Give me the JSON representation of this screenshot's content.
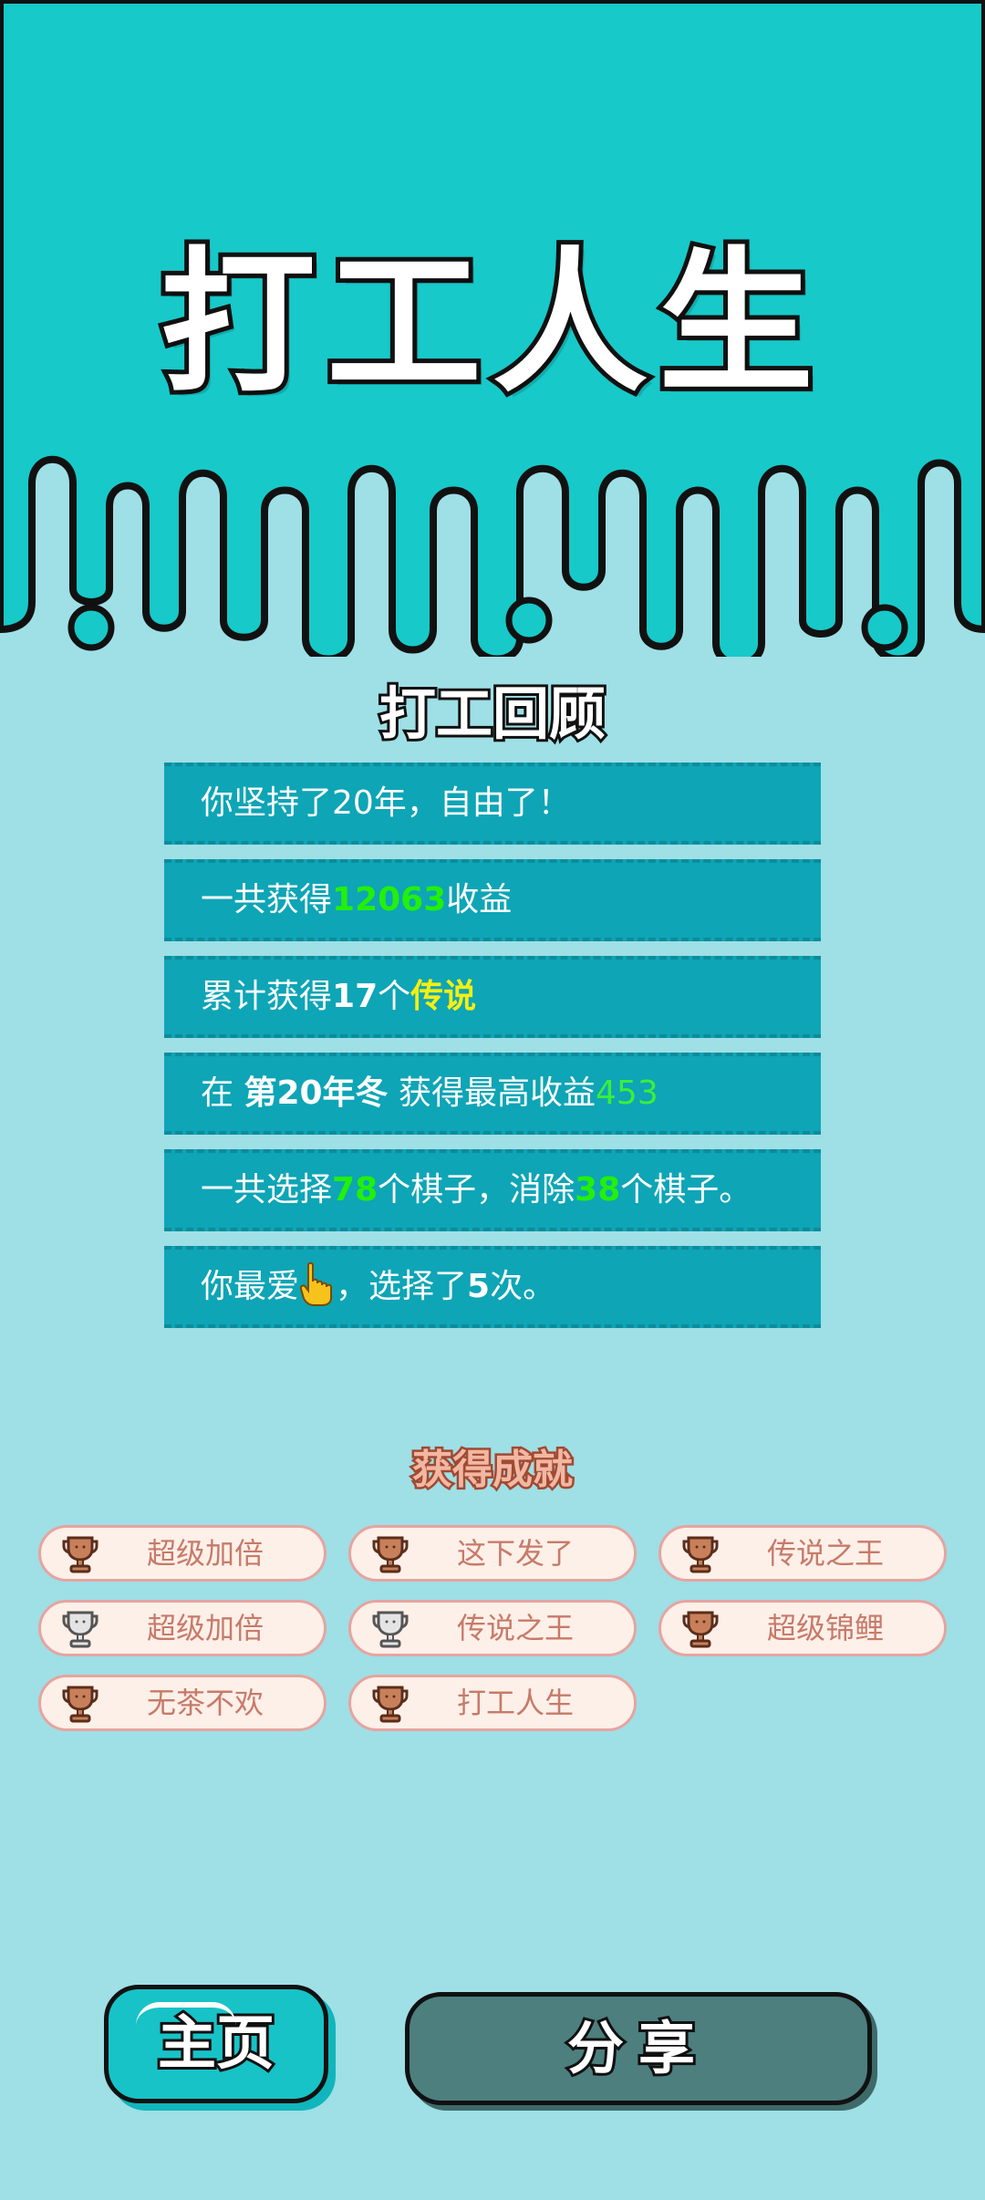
{
  "title": "打工人生",
  "review": {
    "heading": "打工回顾",
    "rows": {
      "years": {
        "text": "你坚持了20年，自由了！"
      },
      "income": {
        "prefix": "一共获得",
        "value": "12063",
        "suffix": "收益"
      },
      "legend": {
        "prefix": "累计获得",
        "count": "17",
        "mid": "个",
        "word": "传说"
      },
      "best": {
        "prefix": "在 ",
        "period": "第20年冬",
        "mid": " 获得最高收益",
        "value": "453"
      },
      "pieces": {
        "prefix": "一共选择",
        "chosen": "78",
        "mid": "个棋子，消除",
        "removed": "38",
        "suffix": "个棋子。"
      },
      "favorite": {
        "prefix": "你最爱",
        "icon": "pointing-hand-icon",
        "mid": "，选择了",
        "count": "5",
        "suffix": "次。"
      }
    }
  },
  "achievements": {
    "heading": "获得成就",
    "items": [
      {
        "label": "超级加倍",
        "trophy": "bronze"
      },
      {
        "label": "这下发了",
        "trophy": "bronze"
      },
      {
        "label": "传说之王",
        "trophy": "bronze"
      },
      {
        "label": "超级加倍",
        "trophy": "silver"
      },
      {
        "label": "传说之王",
        "trophy": "silver"
      },
      {
        "label": "超级锦鲤",
        "trophy": "bronze"
      },
      {
        "label": "无茶不欢",
        "trophy": "bronze"
      },
      {
        "label": "打工人生",
        "trophy": "bronze"
      }
    ]
  },
  "buttons": {
    "home": "主页",
    "share": "分享"
  },
  "colors": {
    "top_band": "#17c9c9",
    "background": "#9fdfe6",
    "row_bg": "#0ea5b6",
    "highlight_green": "#22f00a",
    "highlight_yellow": "#f5ef12",
    "bronze": "#c8805a",
    "silver": "#d8d8d8"
  }
}
